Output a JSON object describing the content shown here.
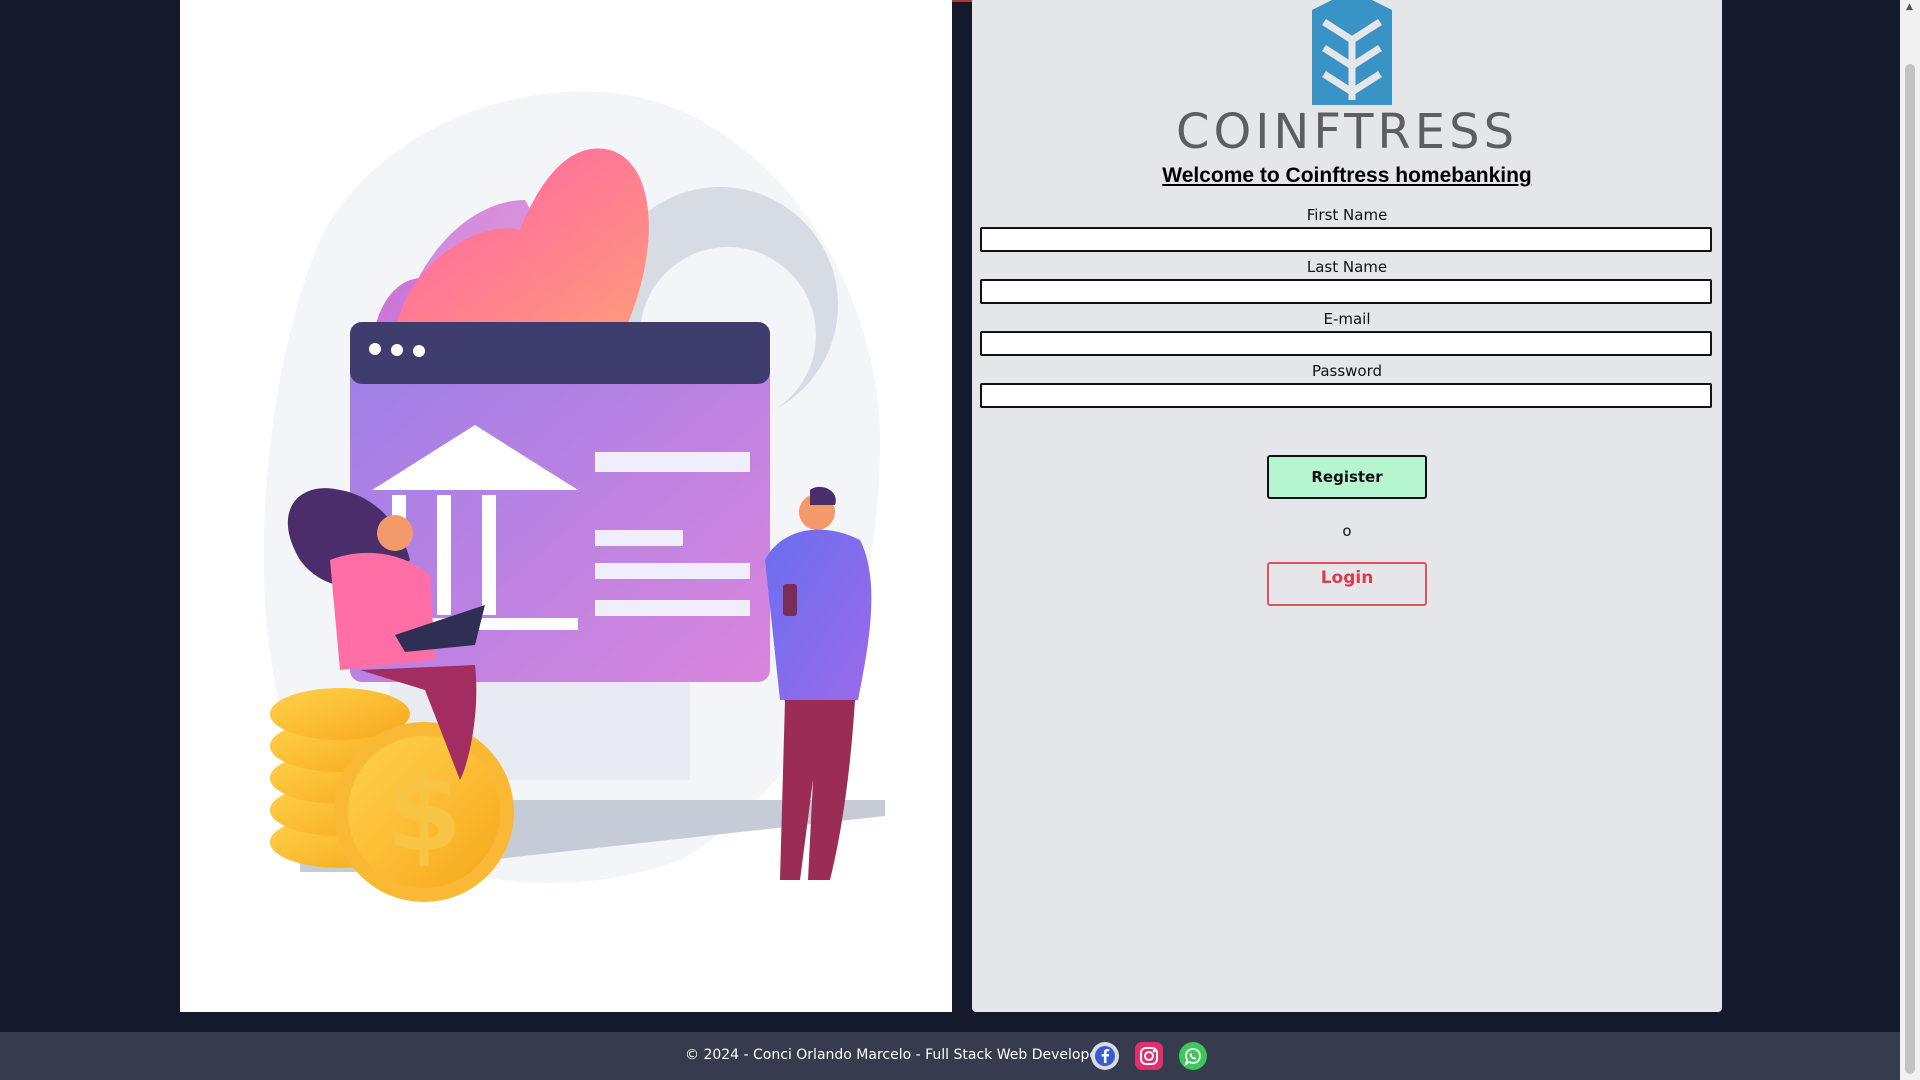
{
  "logo": {
    "text": "COINFTRESS",
    "mark_color": "#3a93c5"
  },
  "form": {
    "title": "Welcome to Coinftress homebanking",
    "fields": [
      {
        "label": "First Name",
        "value": ""
      },
      {
        "label": "Last Name",
        "value": ""
      },
      {
        "label": "E-mail",
        "value": ""
      },
      {
        "label": "Password",
        "value": ""
      }
    ],
    "register_label": "Register",
    "or_text": "o",
    "login_label": "Login"
  },
  "footer": {
    "text": "© 2024 - Conci Orlando Marcelo - Full Stack Web Developer",
    "social": [
      "facebook-icon",
      "instagram-icon",
      "whatsapp-icon"
    ]
  },
  "colors": {
    "page_background": "#141a2b",
    "form_panel": "#e5e6ea",
    "register_button": "#b5f5cf",
    "login_accent": "#dc3c46",
    "footer": "#363c4e"
  }
}
